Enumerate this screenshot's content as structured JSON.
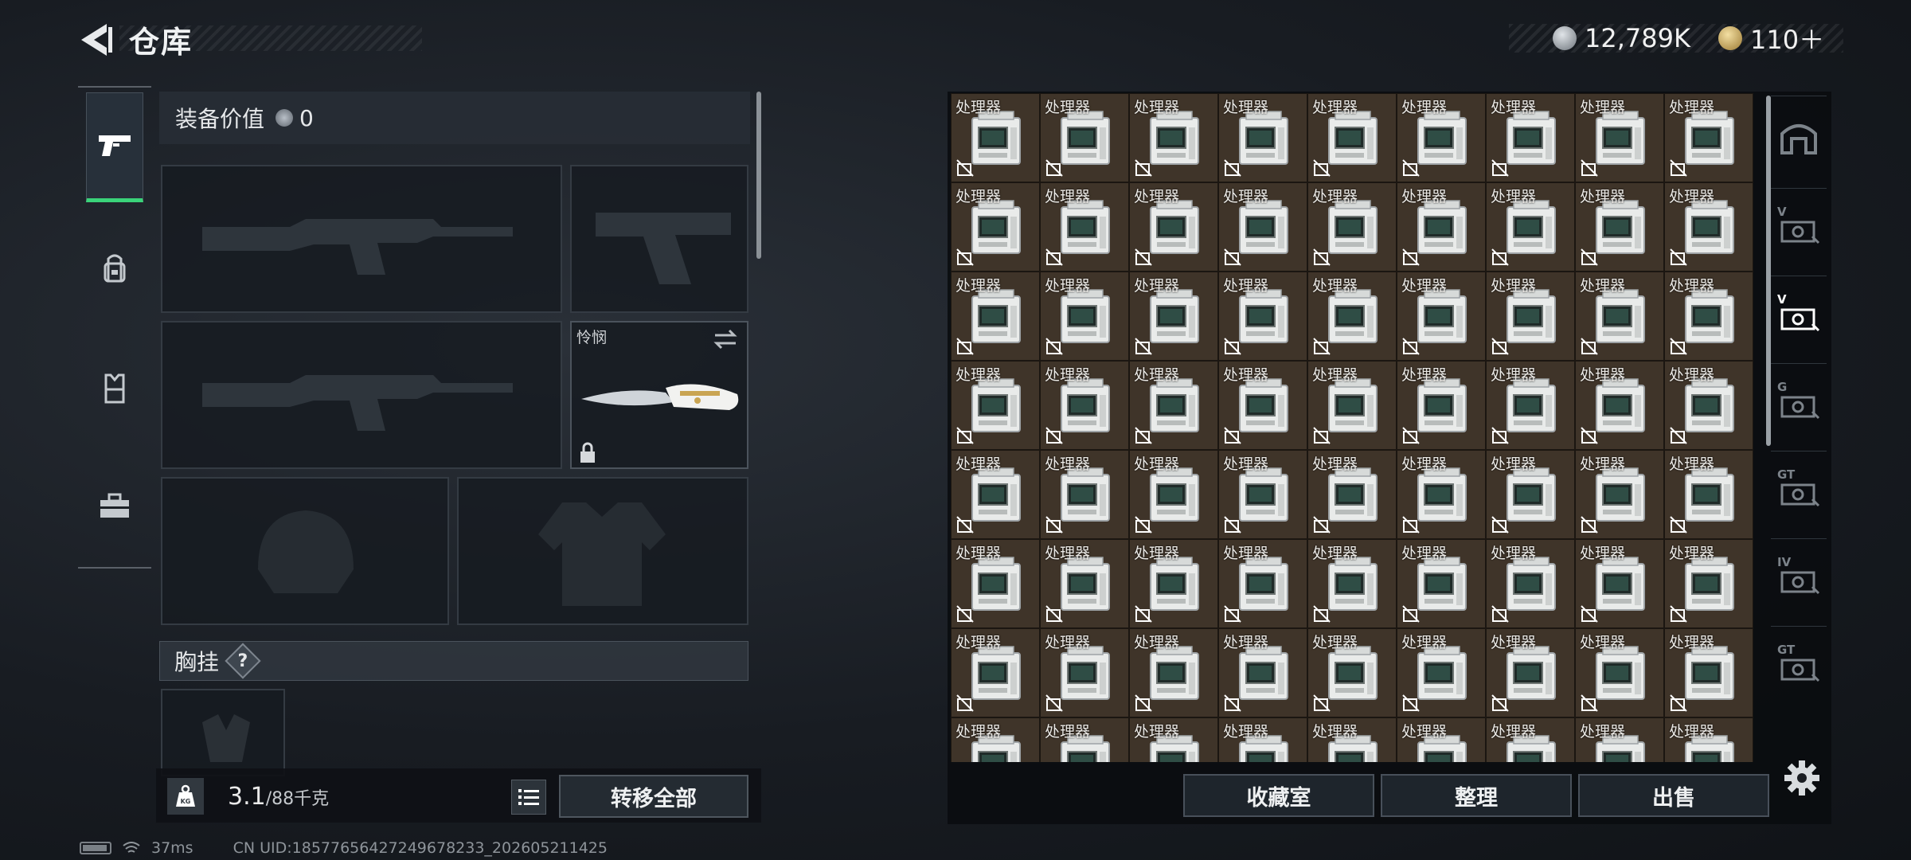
{
  "header": {
    "title": "仓库",
    "currency_primary": "12,789K",
    "currency_secondary": "110＋"
  },
  "categories": [
    {
      "icon": "pistol-icon",
      "active": true
    },
    {
      "icon": "backpack-icon",
      "active": false
    },
    {
      "icon": "vest-icon",
      "active": false
    },
    {
      "icon": "toolbox-icon",
      "active": false
    }
  ],
  "equipment": {
    "value_label": "装备价值",
    "value": "0",
    "melee_name": "怜悯",
    "chest_label": "胸挂",
    "help": "?"
  },
  "weight": {
    "current": "3.1",
    "max": "/88千克"
  },
  "buttons": {
    "transfer_all": "转移全部",
    "collection": "收藏室",
    "organize": "整理",
    "sell": "出售"
  },
  "inventory": {
    "item_name": "处理器",
    "columns": 9,
    "visible_rows": 8,
    "item_icon": "processor-icon",
    "badge_icon": "no-trade-icon"
  },
  "filters": [
    {
      "icon": "home-filter-icon",
      "label": ""
    },
    {
      "icon": "tag-v-icon",
      "label": "V"
    },
    {
      "icon": "tag-v-icon",
      "label": "V"
    },
    {
      "icon": "tag-g-icon",
      "label": "G"
    },
    {
      "icon": "tag-gt-icon",
      "label": "GT"
    },
    {
      "icon": "tag-iv-icon",
      "label": "IV"
    },
    {
      "icon": "tag-gt-icon",
      "label": "GT"
    }
  ],
  "status_bar": {
    "ping": "37ms",
    "uid": "CN UID:18577656427249678233_202605211425"
  },
  "colors": {
    "accent_green": "#3ad37a",
    "item_bg": "#3f3429"
  }
}
